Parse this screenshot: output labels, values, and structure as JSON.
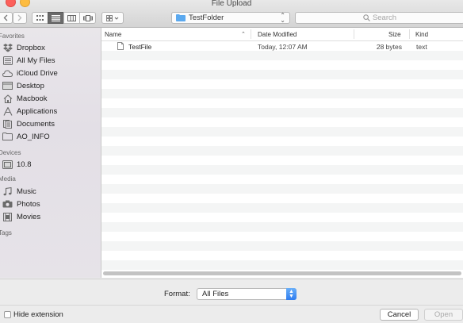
{
  "window": {
    "title": "File Upload"
  },
  "toolbar": {
    "path_popup": "TestFolder",
    "search_placeholder": "Search",
    "selected_view": "list"
  },
  "sidebar": {
    "favorites_label": "Favorites",
    "favorites": [
      {
        "label": "Dropbox",
        "icon": "dropbox-icon"
      },
      {
        "label": "All My Files",
        "icon": "all-files-icon"
      },
      {
        "label": "iCloud Drive",
        "icon": "cloud-icon"
      },
      {
        "label": "Desktop",
        "icon": "desktop-icon"
      },
      {
        "label": "Macbook",
        "icon": "home-icon"
      },
      {
        "label": "Applications",
        "icon": "applications-icon"
      },
      {
        "label": "Documents",
        "icon": "documents-icon"
      },
      {
        "label": "AO_INFO",
        "icon": "folder-icon"
      }
    ],
    "devices_label": "Devices",
    "devices": [
      {
        "label": "10.8",
        "icon": "disk-icon"
      }
    ],
    "media_label": "Media",
    "media": [
      {
        "label": "Music",
        "icon": "music-icon"
      },
      {
        "label": "Photos",
        "icon": "camera-icon"
      },
      {
        "label": "Movies",
        "icon": "film-icon"
      }
    ],
    "tags_label": "Tags"
  },
  "file_list": {
    "columns": {
      "name": "Name",
      "date": "Date Modified",
      "size": "Size",
      "kind": "Kind"
    },
    "files": [
      {
        "name": "TestFile",
        "date": "Today, 12:07 AM",
        "size": "28 bytes",
        "kind": "text"
      }
    ]
  },
  "accessory": {
    "format_label": "Format:",
    "format_value": "All Files"
  },
  "footer": {
    "hide_extension_label": "Hide extension",
    "hide_extension_checked": false,
    "cancel_label": "Cancel",
    "open_label": "Open"
  }
}
